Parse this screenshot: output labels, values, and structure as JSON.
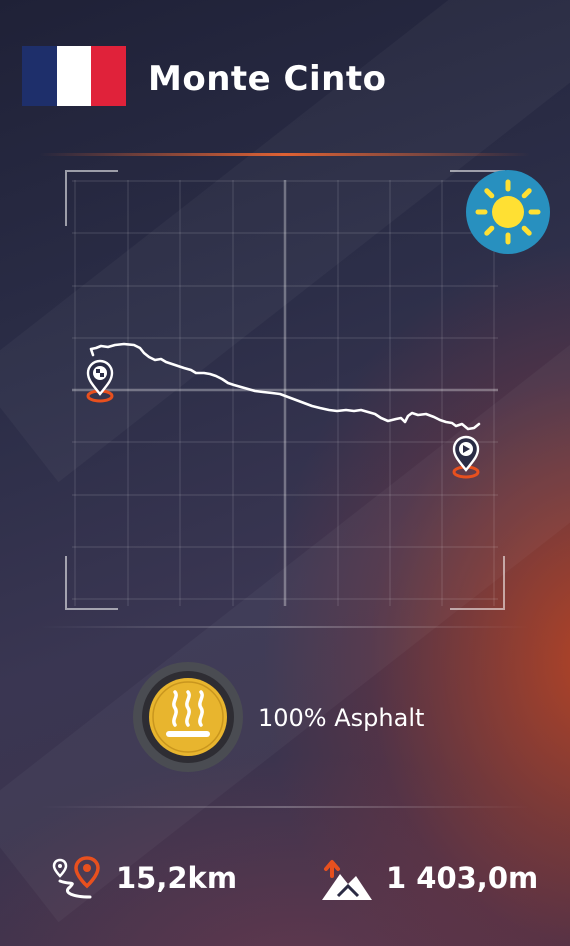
{
  "header": {
    "country_flag": "france-flag-icon",
    "flag_colors": [
      "#1e2f6b",
      "#ffffff",
      "#e0223a"
    ],
    "title": "Monte Cinto"
  },
  "map": {
    "weather_icon": "sun-icon",
    "start_icon": "checkered-flag-pin-icon",
    "end_icon": "play-pin-icon",
    "route_color": "#ffffff",
    "marker_color": "#e8501e"
  },
  "surface": {
    "icon": "heat-asphalt-icon",
    "label": "100% Asphalt"
  },
  "stats": {
    "distance_icon": "route-distance-icon",
    "distance": "15,2km",
    "elevation_icon": "elevation-gain-icon",
    "elevation": "1 403,0m"
  },
  "colors": {
    "accent": "#e8642e",
    "weather_bg": "#2890bf",
    "sun": "#ffe033",
    "badge_gold": "#e8b52e"
  }
}
